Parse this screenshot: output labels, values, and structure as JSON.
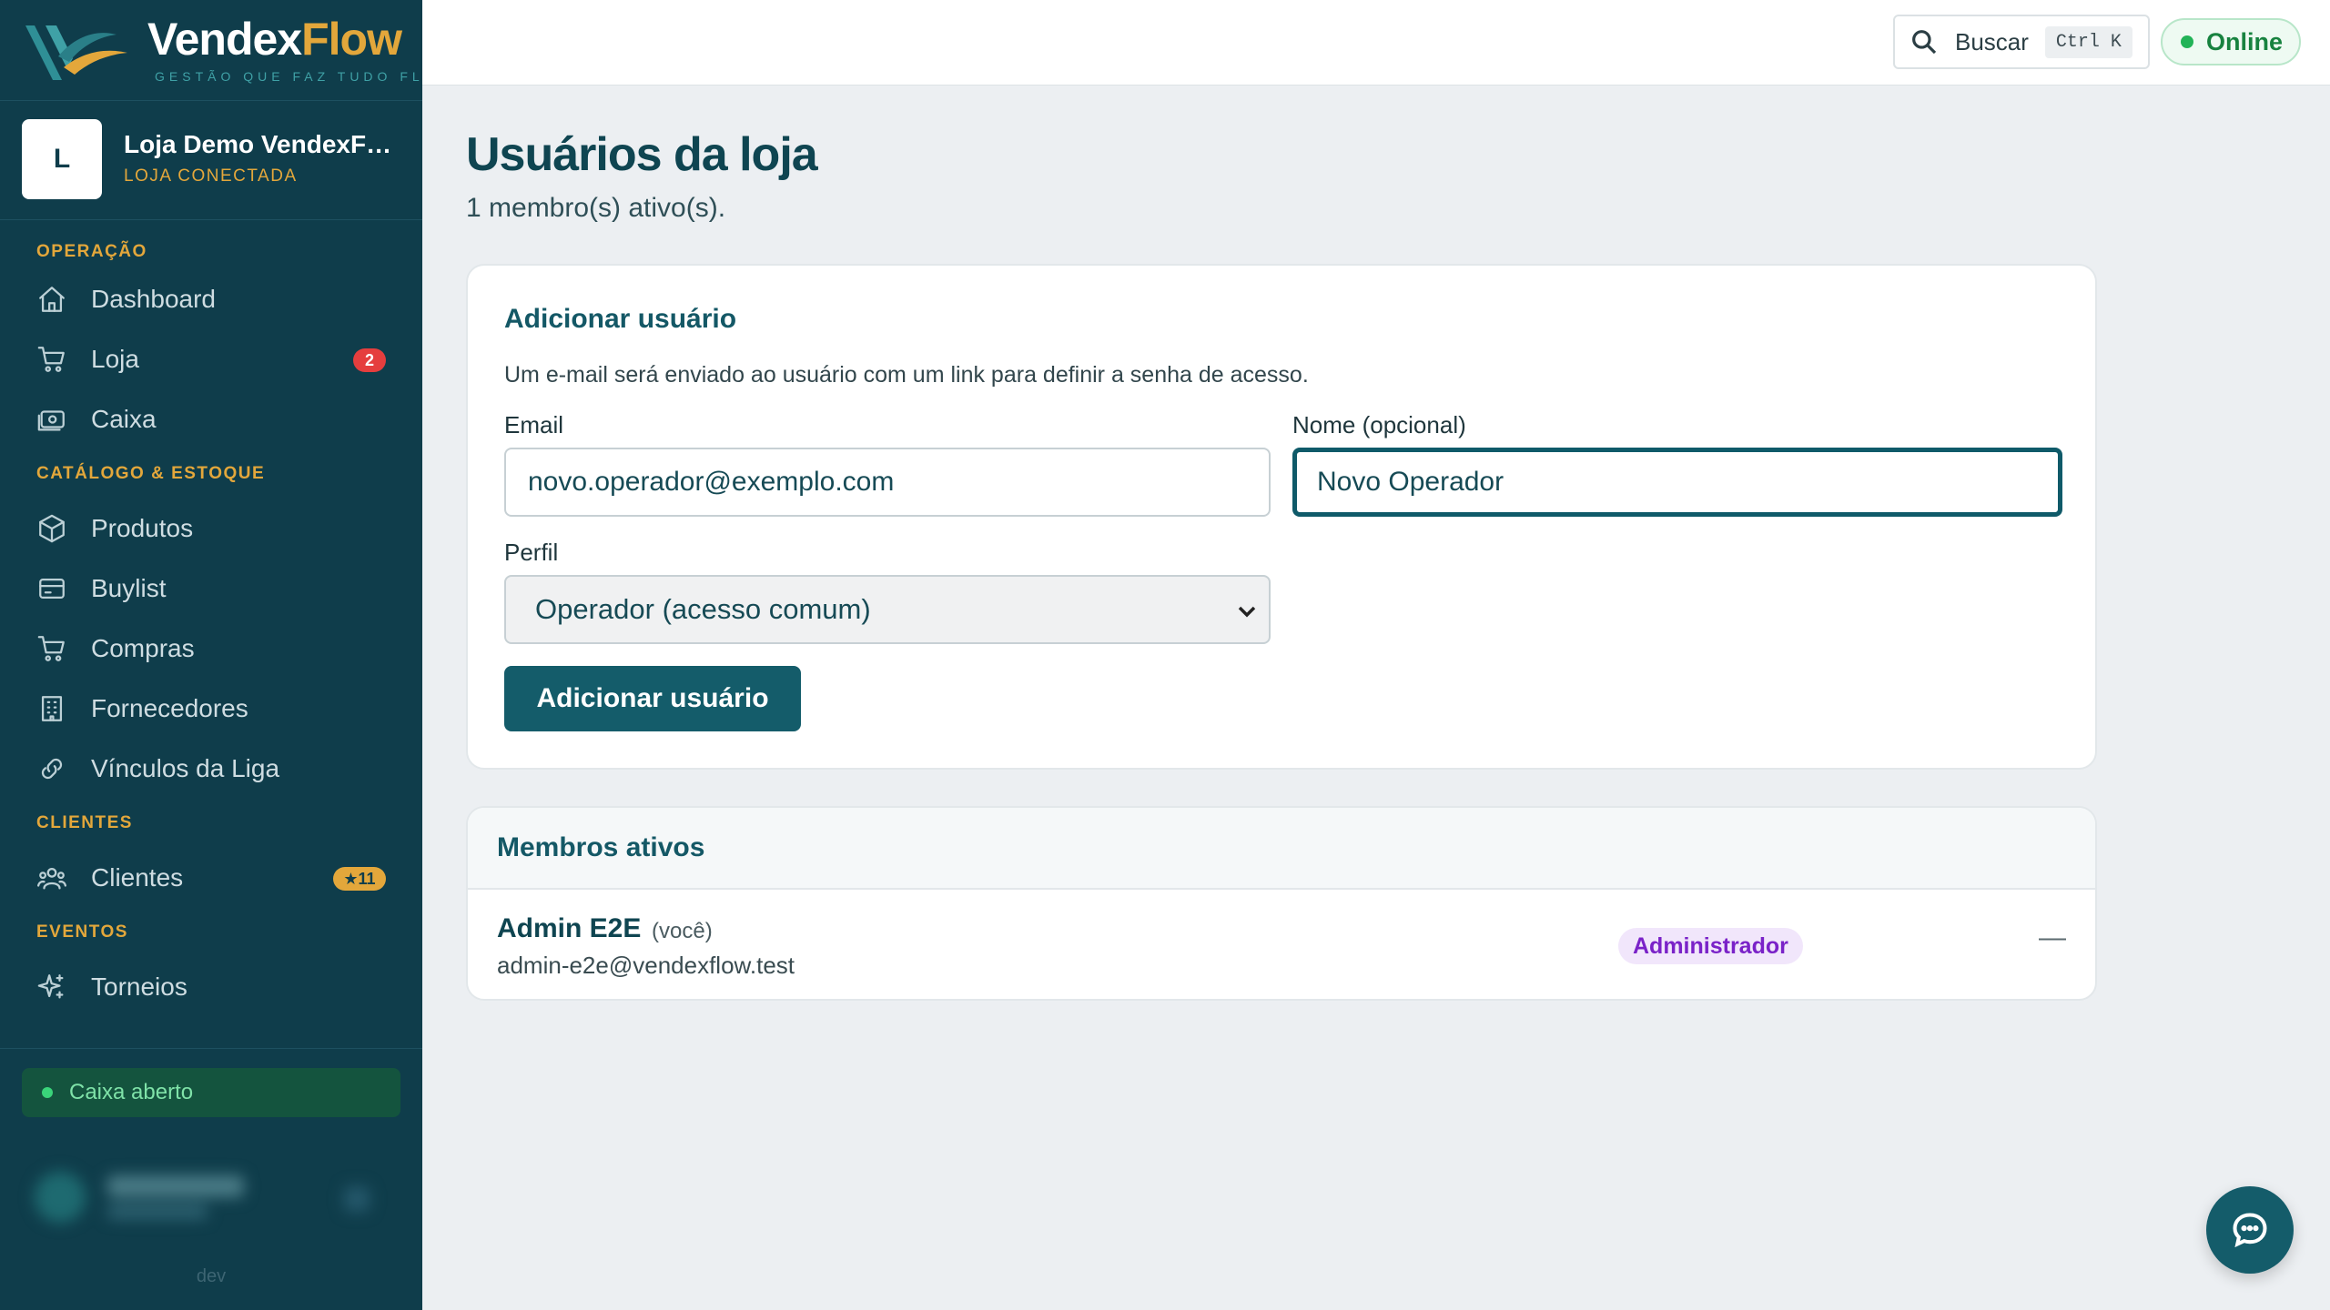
{
  "brand": {
    "name_primary": "Vendex",
    "name_accent": "Flow",
    "tagline": "GESTÃO QUE FAZ TUDO FLUIR"
  },
  "store": {
    "avatar_letter": "L",
    "name": "Loja Demo VendexFlow",
    "status": "LOJA CONECTADA"
  },
  "nav": {
    "sections": {
      "operacao": "OPERAÇÃO",
      "catalogo": "CATÁLOGO & ESTOQUE",
      "clientes": "CLIENTES",
      "eventos": "EVENTOS"
    },
    "items": {
      "dashboard": "Dashboard",
      "loja": "Loja",
      "loja_badge": "2",
      "caixa": "Caixa",
      "produtos": "Produtos",
      "buylist": "Buylist",
      "compras": "Compras",
      "fornecedores": "Fornecedores",
      "vinculos": "Vínculos da Liga",
      "clientes": "Clientes",
      "clientes_badge": "★11",
      "torneios": "Torneios"
    }
  },
  "cash_status": "Caixa aberto",
  "env_label": "dev",
  "topbar": {
    "search_label": "Buscar",
    "search_shortcut": "Ctrl K",
    "status": "Online"
  },
  "page": {
    "title": "Usuários da loja",
    "subtitle": "1 membro(s) ativo(s)."
  },
  "add_user": {
    "title": "Adicionar usuário",
    "description": "Um e-mail será enviado ao usuário com um link para definir a senha de acesso.",
    "email_label": "Email",
    "email_value": "novo.operador@exemplo.com",
    "name_label": "Nome (opcional)",
    "name_value": "Novo Operador",
    "profile_label": "Perfil",
    "profile_value": "Operador (acesso comum)",
    "submit_label": "Adicionar usuário"
  },
  "members": {
    "title": "Membros ativos",
    "rows": [
      {
        "name": "Admin E2E",
        "you": "(você)",
        "email": "admin-e2e@vendexflow.test",
        "role": "Administrador",
        "action": "—"
      }
    ]
  },
  "colors": {
    "sidebar_bg": "#0f3d4b",
    "accent_gold": "#e3a73b",
    "primary": "#145c6a",
    "online_green": "#22b357"
  }
}
